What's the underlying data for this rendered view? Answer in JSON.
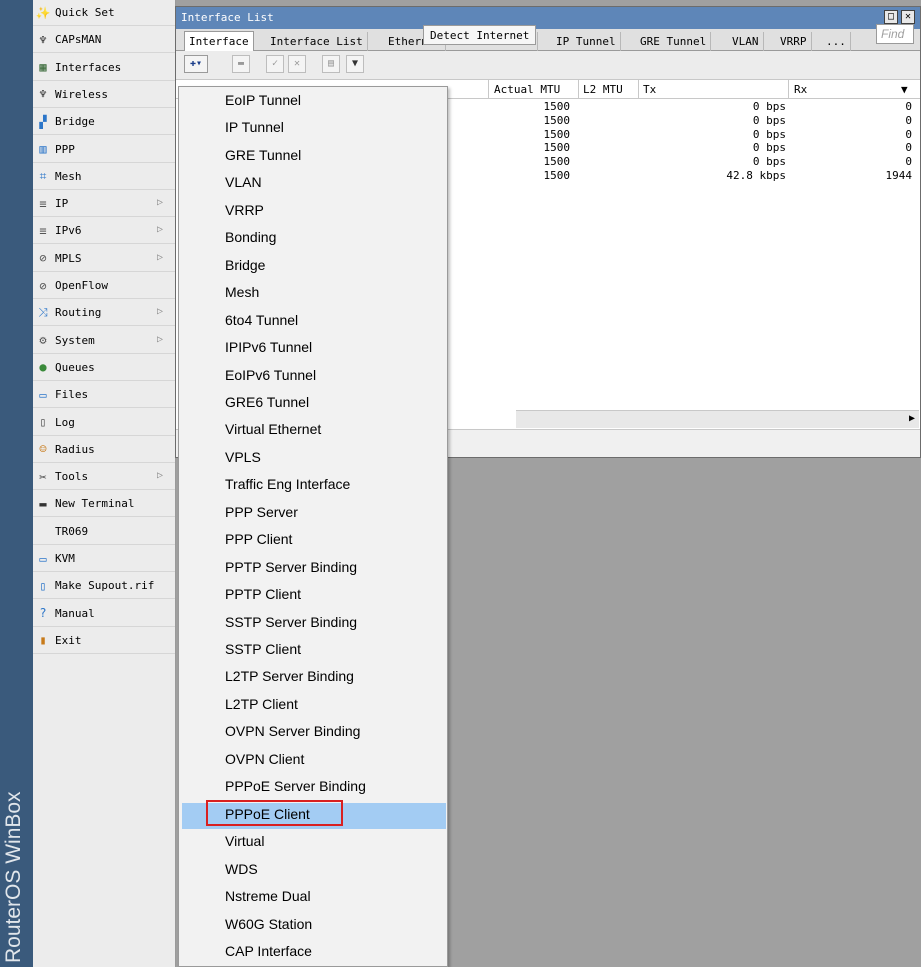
{
  "brand": {
    "text": "RouterOS WinBox"
  },
  "menu": {
    "items": [
      {
        "label": "Quick Set",
        "icon": "magic-wand-icon",
        "glyph": "✨",
        "color": "#5a7a30",
        "submenu": false
      },
      {
        "label": "CAPsMAN",
        "icon": "antenna-icon",
        "glyph": "♆",
        "color": "#2a2a2a",
        "submenu": false
      },
      {
        "label": "Interfaces",
        "icon": "interfaces-icon",
        "glyph": "▦",
        "color": "#3a6a3a",
        "submenu": false
      },
      {
        "label": "Wireless",
        "icon": "antenna-icon",
        "glyph": "♆",
        "color": "#2a2a2a",
        "submenu": false
      },
      {
        "label": "Bridge",
        "icon": "bridge-icon",
        "glyph": "▞",
        "color": "#2c76c9",
        "submenu": false
      },
      {
        "label": "PPP",
        "icon": "ppp-icon",
        "glyph": "▥",
        "color": "#2c76c9",
        "submenu": false
      },
      {
        "label": "Mesh",
        "icon": "mesh-icon",
        "glyph": "⌗",
        "color": "#2c76c9",
        "submenu": false
      },
      {
        "label": "IP",
        "icon": "ip-icon",
        "glyph": "≡",
        "color": "#555555",
        "submenu": true
      },
      {
        "label": "IPv6",
        "icon": "ipv6-icon",
        "glyph": "≡",
        "color": "#555555",
        "submenu": true
      },
      {
        "label": "MPLS",
        "icon": "mpls-icon",
        "glyph": "⊘",
        "color": "#555555",
        "submenu": true
      },
      {
        "label": "OpenFlow",
        "icon": "openflow-icon",
        "glyph": "⊘",
        "color": "#555555",
        "submenu": false
      },
      {
        "label": "Routing",
        "icon": "routing-icon",
        "glyph": "⤨",
        "color": "#2c76c9",
        "submenu": true
      },
      {
        "label": "System",
        "icon": "gear-icon",
        "glyph": "⚙",
        "color": "#555555",
        "submenu": true
      },
      {
        "label": "Queues",
        "icon": "queues-icon",
        "glyph": "●",
        "color": "#3a8a3a",
        "submenu": false
      },
      {
        "label": "Files",
        "icon": "folder-icon",
        "glyph": "▭",
        "color": "#2c76c9",
        "submenu": false
      },
      {
        "label": "Log",
        "icon": "log-icon",
        "glyph": "▯",
        "color": "#555555",
        "submenu": false
      },
      {
        "label": "Radius",
        "icon": "radius-icon",
        "glyph": "☺",
        "color": "#c77a1a",
        "submenu": false
      },
      {
        "label": "Tools",
        "icon": "tools-icon",
        "glyph": "✂",
        "color": "#333333",
        "submenu": true
      },
      {
        "label": "New Terminal",
        "icon": "terminal-icon",
        "glyph": "▬",
        "color": "#333333",
        "submenu": false
      },
      {
        "label": "TR069",
        "icon": "",
        "glyph": "",
        "color": "#333333",
        "submenu": false
      },
      {
        "label": "KVM",
        "icon": "kvm-icon",
        "glyph": "▭",
        "color": "#2c76c9",
        "submenu": false
      },
      {
        "label": "Make Supout.rif",
        "icon": "document-icon",
        "glyph": "▯",
        "color": "#2c76c9",
        "submenu": false
      },
      {
        "label": "Manual",
        "icon": "help-icon",
        "glyph": "?",
        "color": "#2c76c9",
        "submenu": false
      },
      {
        "label": "Exit",
        "icon": "exit-icon",
        "glyph": "▮",
        "color": "#c77a1a",
        "submenu": false
      }
    ]
  },
  "window": {
    "title": "Interface List",
    "tabs": [
      "Interface",
      "Interface List",
      "Ethernet",
      "EoIP Tunnel",
      "IP Tunnel",
      "GRE Tunnel",
      "VLAN",
      "VRRP",
      "..."
    ],
    "active_tab": "Interface",
    "detect_label": "Detect Internet",
    "find_placeholder": "Find",
    "columns": [
      "Actual MTU",
      "L2 MTU",
      "Tx",
      "Rx"
    ],
    "rows": [
      {
        "actual_mtu": "1500",
        "l2_mtu": "",
        "tx": "0 bps",
        "rx": "0"
      },
      {
        "actual_mtu": "1500",
        "l2_mtu": "",
        "tx": "0 bps",
        "rx": "0"
      },
      {
        "actual_mtu": "1500",
        "l2_mtu": "",
        "tx": "0 bps",
        "rx": "0"
      },
      {
        "actual_mtu": "1500",
        "l2_mtu": "",
        "tx": "0 bps",
        "rx": "0"
      },
      {
        "actual_mtu": "1500",
        "l2_mtu": "",
        "tx": "0 bps",
        "rx": "0"
      },
      {
        "actual_mtu": "1500",
        "l2_mtu": "",
        "tx": "42.8 kbps",
        "rx": "1944"
      }
    ]
  },
  "dropdown": {
    "items": [
      "EoIP Tunnel",
      "IP Tunnel",
      "GRE Tunnel",
      "VLAN",
      "VRRP",
      "Bonding",
      "Bridge",
      "Mesh",
      "6to4 Tunnel",
      "IPIPv6 Tunnel",
      "EoIPv6 Tunnel",
      "GRE6 Tunnel",
      "Virtual Ethernet",
      "VPLS",
      "Traffic Eng Interface",
      "PPP Server",
      "PPP Client",
      "PPTP Server Binding",
      "PPTP Client",
      "SSTP Server Binding",
      "SSTP Client",
      "L2TP Server Binding",
      "L2TP Client",
      "OVPN Server Binding",
      "OVPN Client",
      "PPPoE Server Binding",
      "PPPoE Client",
      "Virtual",
      "WDS",
      "Nstreme Dual",
      "W60G Station",
      "CAP Interface"
    ],
    "highlighted": "PPPoE Client"
  },
  "colors": {
    "titlebar": "#5e86b8",
    "highlight": "#a3ccf3",
    "annotation_box": "#d92020"
  }
}
